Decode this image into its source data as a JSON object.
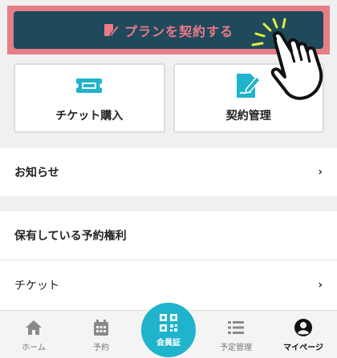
{
  "cta": {
    "label": "プランを契約する"
  },
  "cards": [
    {
      "label": "チケット購入",
      "icon": "ticket-icon"
    },
    {
      "label": "契約管理",
      "icon": "contract-icon"
    }
  ],
  "list": {
    "notice": "お知らせ",
    "reservation_rights_header": "保有している予約権利",
    "ticket": "チケット"
  },
  "nav": {
    "home": "ホーム",
    "reserve": "予約",
    "member": "会員証",
    "schedule": "予定管理",
    "mypage": "マイページ"
  },
  "colors": {
    "cta_bg": "#1e4a5c",
    "cta_text": "#ee7a86",
    "highlight": "#e57f86",
    "accent": "#1fb3cc"
  }
}
